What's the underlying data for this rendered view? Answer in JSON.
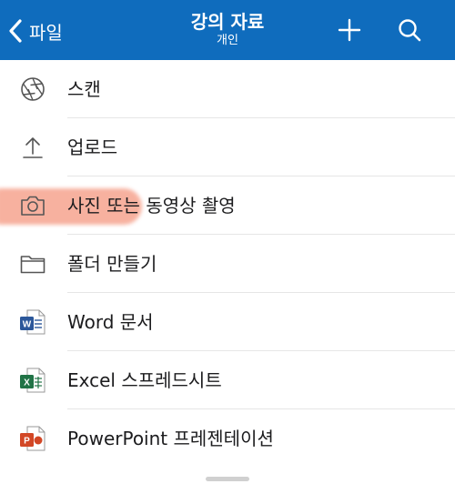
{
  "header": {
    "back_label": "파일",
    "title": "강의 자료",
    "subtitle": "개인",
    "background": "#0f6cbd"
  },
  "menu": {
    "items": [
      {
        "label": "스캔",
        "icon": "camera-aperture-icon"
      },
      {
        "label": "업로드",
        "icon": "upload-arrow-icon"
      },
      {
        "label": "사진 또는 동영상 촬영",
        "icon": "camera-icon"
      },
      {
        "label": "폴더 만들기",
        "icon": "folder-icon"
      },
      {
        "label": "Word 문서",
        "icon": "word-icon"
      },
      {
        "label": "Excel 스프레드시트",
        "icon": "excel-icon"
      },
      {
        "label": "PowerPoint 프레젠테이션",
        "icon": "powerpoint-icon"
      }
    ]
  },
  "colors": {
    "highlight": "#f6a48f",
    "word": "#2b579a",
    "excel": "#217346",
    "powerpoint": "#d24726"
  }
}
